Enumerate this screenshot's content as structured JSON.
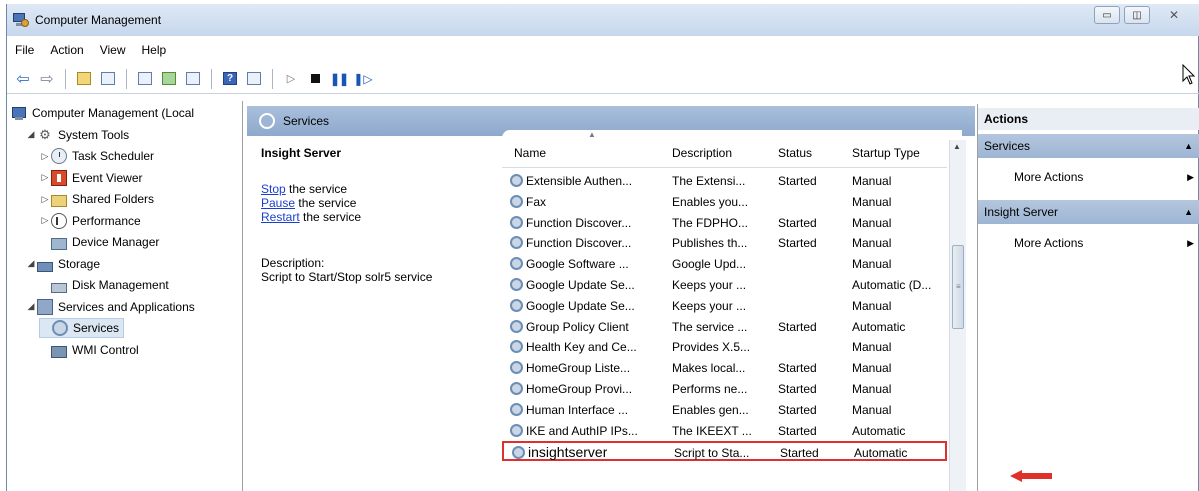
{
  "window": {
    "title": "Computer Management"
  },
  "menu": [
    "File",
    "Action",
    "View",
    "Help"
  ],
  "tree": {
    "items": [
      {
        "label": "Computer Management (Local",
        "icon": "computer-icon",
        "indent": 0,
        "expander": ""
      },
      {
        "label": "System Tools",
        "icon": "tools-icon",
        "indent": 1,
        "expander": "◢"
      },
      {
        "label": "Task Scheduler",
        "icon": "clock-icon",
        "indent": 2,
        "expander": "▷"
      },
      {
        "label": "Event Viewer",
        "icon": "event-icon",
        "indent": 2,
        "expander": "▷"
      },
      {
        "label": "Shared Folders",
        "icon": "folder-icon",
        "indent": 2,
        "expander": "▷"
      },
      {
        "label": "Performance",
        "icon": "performance-icon",
        "indent": 2,
        "expander": "▷"
      },
      {
        "label": "Device Manager",
        "icon": "device-icon",
        "indent": 2,
        "expander": ""
      },
      {
        "label": "Storage",
        "icon": "storage-icon",
        "indent": 1,
        "expander": "◢"
      },
      {
        "label": "Disk Management",
        "icon": "disk-icon",
        "indent": 2,
        "expander": ""
      },
      {
        "label": "Services and Applications",
        "icon": "services-apps-icon",
        "indent": 1,
        "expander": "◢"
      },
      {
        "label": "Services",
        "icon": "gear-icon",
        "indent": 2,
        "expander": "",
        "selected": true
      },
      {
        "label": "WMI Control",
        "icon": "wmi-icon",
        "indent": 2,
        "expander": ""
      }
    ]
  },
  "center": {
    "header": "Services",
    "detail": {
      "title": "Insight Server",
      "links": [
        {
          "link": "Stop",
          "rest": " the service"
        },
        {
          "link": "Pause",
          "rest": " the service"
        },
        {
          "link": "Restart",
          "rest": " the service"
        }
      ],
      "description_label": "Description:",
      "description": "Script to Start/Stop solr5 service"
    },
    "columns": [
      "Name",
      "Description",
      "Status",
      "Startup Type"
    ],
    "rows": [
      {
        "name": "Extensible Authen...",
        "description": "The Extensi...",
        "status": "Started",
        "startup": "Manual"
      },
      {
        "name": "Fax",
        "description": "Enables you...",
        "status": "",
        "startup": "Manual"
      },
      {
        "name": "Function Discover...",
        "description": "The FDPHO...",
        "status": "Started",
        "startup": "Manual"
      },
      {
        "name": "Function Discover...",
        "description": "Publishes th...",
        "status": "Started",
        "startup": "Manual"
      },
      {
        "name": "Google Software ...",
        "description": "Google Upd...",
        "status": "",
        "startup": "Manual"
      },
      {
        "name": "Google Update Se...",
        "description": "Keeps your ...",
        "status": "",
        "startup": "Automatic (D..."
      },
      {
        "name": "Google Update Se...",
        "description": "Keeps your ...",
        "status": "",
        "startup": "Manual"
      },
      {
        "name": "Group Policy Client",
        "description": "The service ...",
        "status": "Started",
        "startup": "Automatic"
      },
      {
        "name": "Health Key and Ce...",
        "description": "Provides X.5...",
        "status": "",
        "startup": "Manual"
      },
      {
        "name": "HomeGroup Liste...",
        "description": "Makes local...",
        "status": "Started",
        "startup": "Manual"
      },
      {
        "name": "HomeGroup Provi...",
        "description": "Performs ne...",
        "status": "Started",
        "startup": "Manual"
      },
      {
        "name": "Human Interface ...",
        "description": "Enables gen...",
        "status": "Started",
        "startup": "Manual"
      },
      {
        "name": "IKE and AuthIP IPs...",
        "description": "The IKEEXT ...",
        "status": "Started",
        "startup": "Automatic"
      },
      {
        "name": "insightserver",
        "description": "Script to Sta...",
        "status": "Started",
        "startup": "Automatic",
        "highlighted": true
      }
    ],
    "scroll_position": 0.38
  },
  "actions": {
    "header": "Actions",
    "sections": [
      {
        "title": "Services",
        "item": "More Actions"
      },
      {
        "title": "Insight Server",
        "item": "More Actions"
      }
    ]
  },
  "colors": {
    "highlight_border": "#e0302c",
    "section_blue": "#9db5d4",
    "link": "#1a3fcf"
  }
}
